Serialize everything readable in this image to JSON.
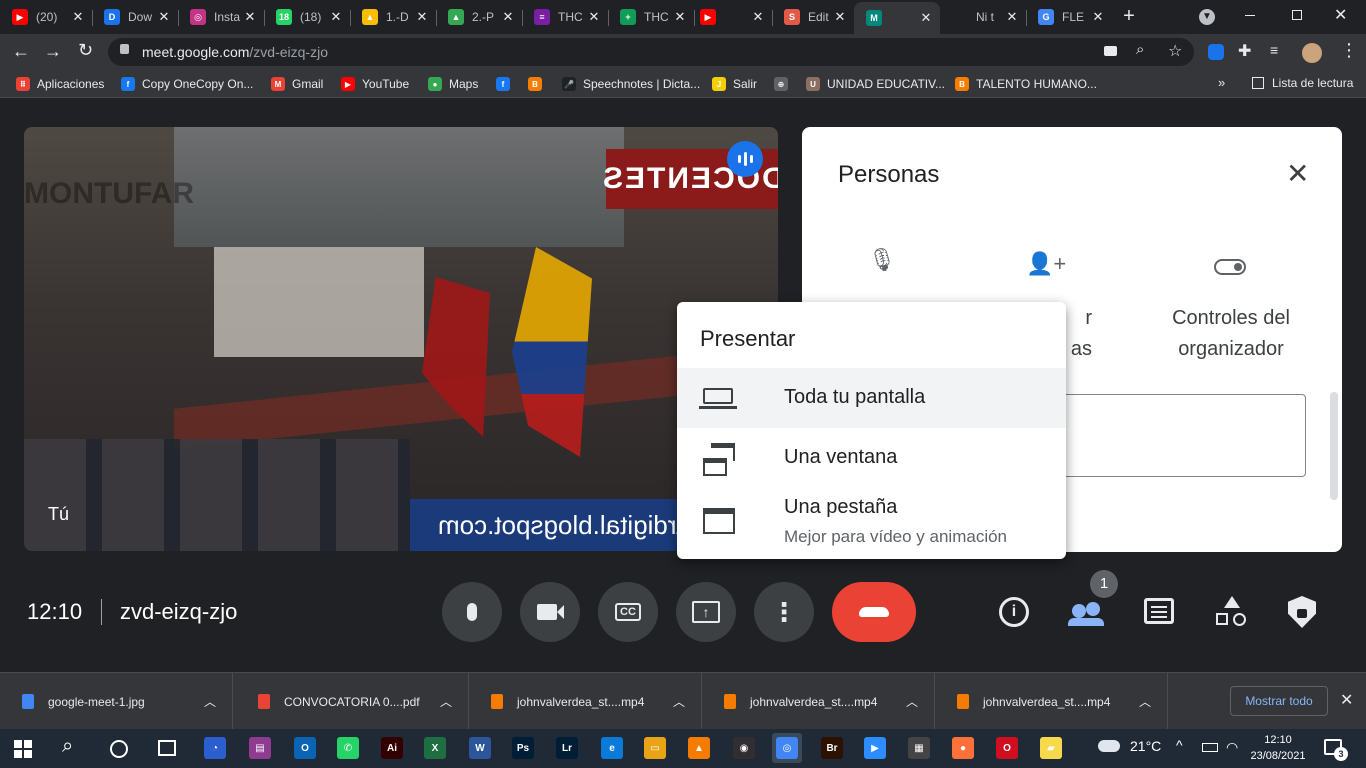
{
  "tabs": [
    {
      "title": "(20)",
      "fav_color": "#ff0000",
      "fav_glyph": "▶"
    },
    {
      "title": "Dow",
      "fav_color": "#1a73e8",
      "fav_glyph": "D"
    },
    {
      "title": "Insta",
      "fav_color": "#c13584",
      "fav_glyph": "◎"
    },
    {
      "title": "(18)",
      "fav_color": "#25d366",
      "fav_glyph": "18"
    },
    {
      "title": "1.-D",
      "fav_color": "#fbbc04",
      "fav_glyph": "▲"
    },
    {
      "title": "2.-P",
      "fav_color": "#34a853",
      "fav_glyph": "▲"
    },
    {
      "title": "THC",
      "fav_color": "#7b1fa2",
      "fav_glyph": "≡"
    },
    {
      "title": "THC",
      "fav_color": "#0f9d58",
      "fav_glyph": "+"
    },
    {
      "title": "",
      "fav_color": "#ff0000",
      "fav_glyph": "▶"
    },
    {
      "title": "Edit",
      "fav_color": "#e05a47",
      "fav_glyph": "S"
    },
    {
      "title": "",
      "fav_color": "#00897b",
      "fav_glyph": "M"
    },
    {
      "title": "Ni t",
      "fav_color": "#202124",
      "fav_glyph": ""
    },
    {
      "title": "FLE",
      "fav_color": "#4285f4",
      "fav_glyph": "G"
    }
  ],
  "address": {
    "host": "meet.google.com",
    "path": "/zvd-eizq-zjo"
  },
  "bookmarks": [
    {
      "label": "Aplicaciones",
      "fav_color": "#ea4335",
      "fav_glyph": "⠿"
    },
    {
      "label": "Copy OneCopy On...",
      "fav_color": "#1877f2",
      "fav_glyph": "f"
    },
    {
      "label": "Gmail",
      "fav_color": "#ea4335",
      "fav_glyph": "M"
    },
    {
      "label": "YouTube",
      "fav_color": "#ff0000",
      "fav_glyph": "▶"
    },
    {
      "label": "Maps",
      "fav_color": "#34a853",
      "fav_glyph": "●"
    },
    {
      "label": "",
      "fav_color": "#1877f2",
      "fav_glyph": "f"
    },
    {
      "label": "",
      "fav_color": "#f57d00",
      "fav_glyph": "B"
    },
    {
      "label": "Speechnotes | Dicta...",
      "fav_color": "#202124",
      "fav_glyph": "🎤"
    },
    {
      "label": "Salir",
      "fav_color": "#f5d000",
      "fav_glyph": "J"
    },
    {
      "label": "",
      "fav_color": "#5f6368",
      "fav_glyph": "⊕"
    },
    {
      "label": "UNIDAD EDUCATIV...",
      "fav_color": "#8d6e63",
      "fav_glyph": "U"
    },
    {
      "label": "TALENTO HUMANO...",
      "fav_color": "#f57d00",
      "fav_glyph": "B"
    }
  ],
  "reading_list": "Lista de lectura",
  "video": {
    "self_label": "Tú",
    "banner": "DOCENTES",
    "watermark": "MONTUFAR",
    "url_text": "ufardigital.blogspot.com"
  },
  "people": {
    "title": "Personas",
    "actions": [
      {
        "label": "",
        "icon": "mic-off-icon"
      },
      {
        "label": "r\nas",
        "icon": "add-person-icon"
      },
      {
        "label": "Controles del\norganizador",
        "icon": "toggle-icon"
      }
    ]
  },
  "present_menu": {
    "title": "Presentar",
    "items": [
      {
        "label": "Toda tu pantalla",
        "sub": "",
        "icon": "laptop-icon"
      },
      {
        "label": "Una ventana",
        "sub": "",
        "icon": "window-icon"
      },
      {
        "label": "Una pestaña",
        "sub": "Mejor para vídeo y animación",
        "icon": "tab-icon"
      }
    ]
  },
  "meeting": {
    "time": "12:10",
    "code": "zvd-eizq-zjo",
    "participants_count": "1"
  },
  "downloads": [
    {
      "name": "google-meet-1.jpg",
      "icon_color": "#4285f4"
    },
    {
      "name": "CONVOCATORIA 0....pdf",
      "icon_color": "#ea4335"
    },
    {
      "name": "johnvalverdea_st....mp4",
      "icon_color": "#f57c00"
    },
    {
      "name": "johnvalverdea_st....mp4",
      "icon_color": "#f57c00"
    },
    {
      "name": "johnvalverdea_st....mp4",
      "icon_color": "#f57c00"
    }
  ],
  "show_all": "Mostrar todo",
  "taskbar": {
    "apps": [
      {
        "name": "firefox-dev",
        "color": "#2b5ecf",
        "glyph": "◔"
      },
      {
        "name": "winrar",
        "color": "#8e3b91",
        "glyph": "▤"
      },
      {
        "name": "outlook",
        "color": "#0a64b5",
        "glyph": "O"
      },
      {
        "name": "whatsapp",
        "color": "#25d366",
        "glyph": "✆"
      },
      {
        "name": "illustrator",
        "color": "#330000",
        "glyph": "Ai"
      },
      {
        "name": "excel",
        "color": "#1d6f42",
        "glyph": "X"
      },
      {
        "name": "word",
        "color": "#2b579a",
        "glyph": "W"
      },
      {
        "name": "photoshop",
        "color": "#001e36",
        "glyph": "Ps"
      },
      {
        "name": "lightroom",
        "color": "#001e36",
        "glyph": "Lr"
      },
      {
        "name": "edge",
        "color": "#0c7bd7",
        "glyph": "e"
      },
      {
        "name": "explorer",
        "color": "#e8a317",
        "glyph": "▭"
      },
      {
        "name": "vlc",
        "color": "#f57c00",
        "glyph": "▲"
      },
      {
        "name": "obs",
        "color": "#302e31",
        "glyph": "◉"
      },
      {
        "name": "chrome",
        "color": "#4285f4",
        "glyph": "◎"
      },
      {
        "name": "bridge",
        "color": "#2b1300",
        "glyph": "Br"
      },
      {
        "name": "zoom",
        "color": "#2d8cff",
        "glyph": "▶"
      },
      {
        "name": "calculator",
        "color": "#444",
        "glyph": "▦"
      },
      {
        "name": "firefox",
        "color": "#ff7139",
        "glyph": "●"
      },
      {
        "name": "opera",
        "color": "#d10e1e",
        "glyph": "O"
      },
      {
        "name": "sticky-notes",
        "color": "#f7d94c",
        "glyph": "▰"
      }
    ],
    "temperature": "21°C",
    "clock_time": "12:10",
    "clock_date": "23/08/2021",
    "notifications": "3"
  }
}
